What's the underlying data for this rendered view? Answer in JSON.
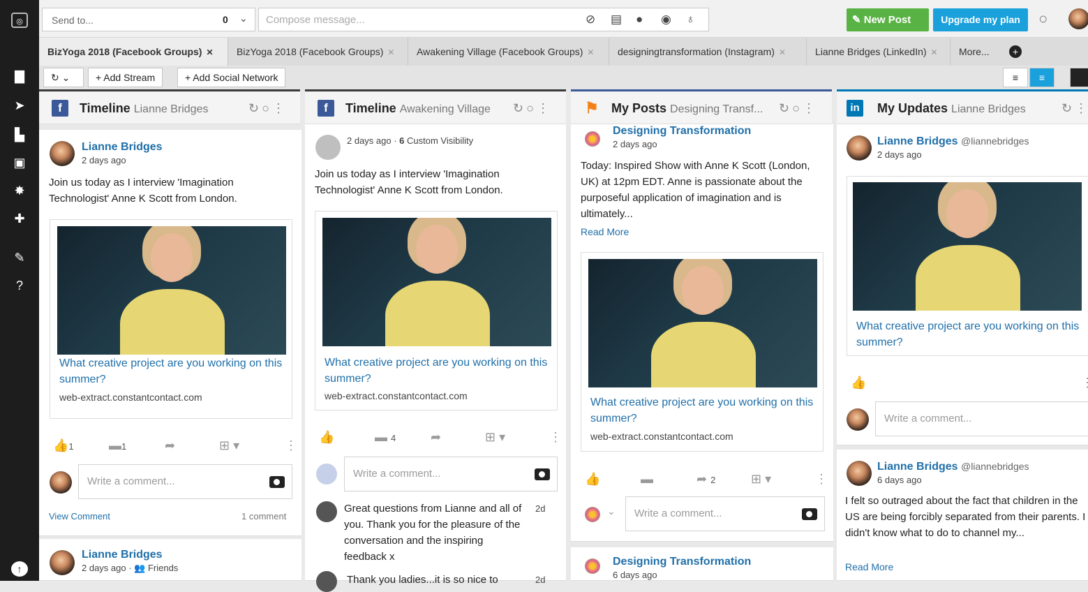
{
  "topbar": {
    "send_to_placeholder": "Send to...",
    "send_to_count": "0",
    "compose_placeholder": "Compose message...",
    "new_post_label": "New Post",
    "upgrade_label": "Upgrade my plan"
  },
  "tabs": [
    {
      "label": "BizYoga 2018 (Facebook Groups)",
      "active": true
    },
    {
      "label": "BizYoga 2018 (Facebook Groups)"
    },
    {
      "label": "Awakening Village (Facebook Groups)"
    },
    {
      "label": "designingtransformation (Instagram)"
    },
    {
      "label": "Lianne Bridges (LinkedIn)"
    },
    {
      "label": "More..."
    }
  ],
  "toolbar": {
    "add_stream_label": "+ Add Stream",
    "add_social_label": "+ Add Social Network"
  },
  "columns": [
    {
      "title": "Timeline",
      "subtitle": "Lianne Bridges",
      "post": {
        "author": "Lianne Bridges",
        "time": "2 days ago",
        "text": "Join us today as I interview 'Imagination Technologist' Anne K Scott from London.",
        "link_title": "What creative project are you working on this summer?",
        "link_domain": "web-extract.constantcontact.com",
        "likes": "1",
        "comments": "1",
        "comment_placeholder": "Write a comment...",
        "view_comment": "View Comment",
        "comment_count": "1 comment"
      },
      "post2": {
        "author": "Lianne Bridges",
        "time": "2 days ago · 👥 Friends"
      }
    },
    {
      "title": "Timeline",
      "subtitle": "Awakening Village",
      "post": {
        "time": "2 days ago ·",
        "visibility": "Custom Visibility",
        "text": "Join us today as I interview 'Imagination Technologist' Anne K Scott from London.",
        "link_title": "What creative project are you working on this summer?",
        "link_domain": "web-extract.constantcontact.com",
        "comments": "4",
        "comment_placeholder": "Write a comment...",
        "reply1": "Great questions from Lianne and all of you. Thank you for the pleasure of the conversation and the inspiring feedback x",
        "reply1_time": "2d",
        "reply2": "Thank you ladies...it is so nice to",
        "reply2_time": "2d"
      }
    },
    {
      "title": "My Posts",
      "subtitle": "Designing Transf...",
      "post": {
        "author": "Designing Transformation",
        "time": "2 days ago",
        "text": "Today: Inspired Show with Anne K Scott (London, UK) at 12pm EDT. Anne is passionate about the purposeful application of imagination and is ultimately...",
        "read_more": "Read More",
        "link_title": "What creative project are you working on this summer?",
        "link_domain": "web-extract.constantcontact.com",
        "shares": "2",
        "comment_placeholder": "Write a comment..."
      },
      "post2": {
        "author": "Designing Transformation",
        "time": "6 days ago"
      }
    },
    {
      "title": "My Updates",
      "subtitle": "Lianne Bridges",
      "post": {
        "author": "Lianne Bridges",
        "handle": "@liannebridges",
        "time": "2 days ago",
        "link_title": "What creative project are you working on this summer?",
        "comment_placeholder": "Write a comment..."
      },
      "post2": {
        "author": "Lianne Bridges",
        "handle": "@liannebridges",
        "time": "6 days ago",
        "text": "I felt so outraged about the fact that children in the US are being forcibly separated from their parents. I didn't know what to do to channel my...",
        "read_more": "Read More"
      }
    }
  ],
  "colors": {
    "facebook": "#3b5998",
    "linkedin": "#0077b5",
    "new_post": "#59b244",
    "upgrade": "#1aa1dc",
    "link": "#1f6fa9"
  }
}
